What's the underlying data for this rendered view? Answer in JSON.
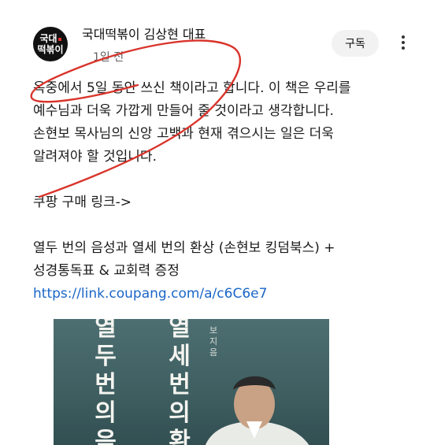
{
  "header": {
    "avatar_line1": "국대",
    "avatar_line2": "떡볶이",
    "author": "국대떡볶이 김상현 대표",
    "time": "1일 전",
    "subscribe_label": "구독"
  },
  "post": {
    "lines": [
      "옥중에서 5일 동안 쓰신 책이라고 합니다. 이 책은 우리를",
      "예수님과 더욱 가깝게 만들어 줄 것이라고 생각합니다.",
      "손현보 목사님의 신앙 고백과 현재 겪으시는 일은 더욱",
      "알려져야 할 것입니다."
    ],
    "buy_link_label": "쿠팡 구매 링크->",
    "product_line1": "열두 번의 음성과 열세 번의 환상 (손현보 킹덤북스) +",
    "product_line2": "성경통독표 & 교회력 증정",
    "url": "https://link.coupang.com/a/c6C6e7"
  },
  "book": {
    "title_col1": "열두번의음",
    "title_col2": "열세번의환",
    "author_vertical": "보지음"
  },
  "colors": {
    "scribble": "#d9342b",
    "link": "#1a66c8",
    "book_cover": "#4d6f71"
  }
}
